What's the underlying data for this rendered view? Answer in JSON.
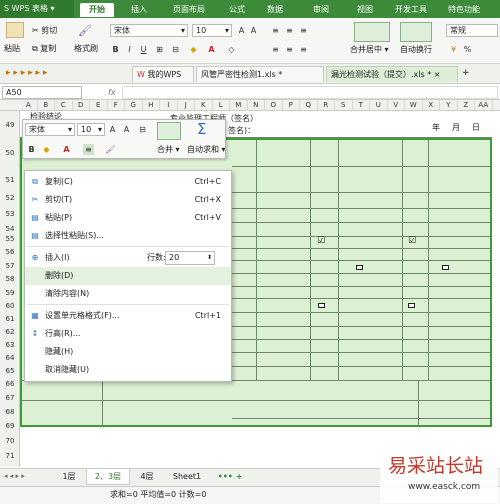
{
  "app": {
    "title": "WPS 表格"
  },
  "menu": {
    "tabs": [
      "开始",
      "插入",
      "页面布局",
      "公式",
      "数据",
      "审阅",
      "视图",
      "开发工具",
      "特色功能"
    ]
  },
  "ribbon": {
    "paste": "粘贴",
    "cut": "剪切",
    "copy": "复制",
    "format_painter": "格式刷",
    "font": "宋体",
    "size": "10",
    "merge_center": "合并居中",
    "wrap_text": "自动换行",
    "number_format": "常规"
  },
  "doc_tabs": [
    "我的WPS",
    "风管严密性检测1.xls *",
    "漏光检测试验（提交）.xls *"
  ],
  "formula_bar": {
    "name_box": "A50",
    "fx": "fx"
  },
  "columns": [
    "A",
    "B",
    "C",
    "D",
    "E",
    "F",
    "G",
    "H",
    "I",
    "J",
    "K",
    "L",
    "M",
    "N",
    "O",
    "P",
    "Q",
    "R",
    "S",
    "T",
    "U",
    "V",
    "W",
    "X",
    "Y",
    "Z",
    "AA"
  ],
  "sheet_text": {
    "row48": "检验结论",
    "row48_b": "专业监理工程师（签名）",
    "sign": "签名)：",
    "year": "年",
    "month": "月",
    "day": "日"
  },
  "rows": [
    "49",
    "50",
    "51",
    "52",
    "53",
    "54",
    "55",
    "56",
    "57",
    "58",
    "59",
    "60",
    "61",
    "62",
    "63",
    "64",
    "65",
    "66",
    "67",
    "68",
    "69",
    "70",
    "71"
  ],
  "mini_toolbar": {
    "font": "宋体",
    "size": "10",
    "merge": "合并",
    "autosum": "自动求和"
  },
  "context_menu": {
    "items": [
      {
        "label": "复制(C)",
        "shortcut": "Ctrl+C"
      },
      {
        "label": "剪切(T)",
        "shortcut": "Ctrl+X"
      },
      {
        "label": "粘贴(P)",
        "shortcut": "Ctrl+V"
      },
      {
        "label": "选择性粘贴(S)...",
        "shortcut": ""
      },
      {
        "label": "插入(I)",
        "shortcut": ""
      },
      {
        "label": "删除(D)",
        "shortcut": ""
      },
      {
        "label": "清除内容(N)",
        "shortcut": ""
      },
      {
        "label": "设置单元格格式(F)...",
        "shortcut": "Ctrl+1"
      },
      {
        "label": "行高(R)...",
        "shortcut": ""
      },
      {
        "label": "隐藏(H)",
        "shortcut": ""
      },
      {
        "label": "取消隐藏(U)",
        "shortcut": ""
      }
    ],
    "rows_label": "行数:",
    "rows_value": "20"
  },
  "sheet_tabs": [
    "1层",
    "2、3层",
    "4层",
    "Sheet1"
  ],
  "status": "求和=0  平均值=0  计数=0",
  "watermark": {
    "brand": "易采站长站",
    "url": "www.easck.com"
  }
}
